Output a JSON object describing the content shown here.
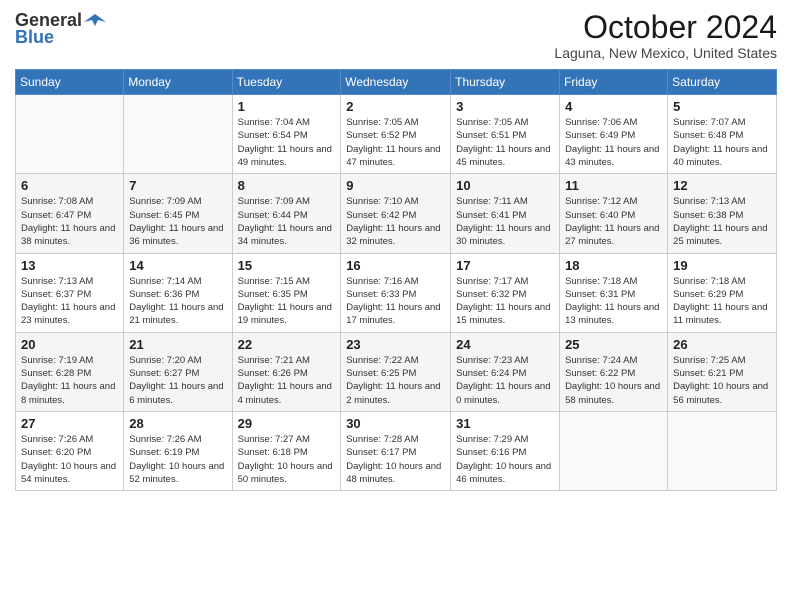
{
  "header": {
    "logo_general": "General",
    "logo_blue": "Blue",
    "month_title": "October 2024",
    "location": "Laguna, New Mexico, United States"
  },
  "weekdays": [
    "Sunday",
    "Monday",
    "Tuesday",
    "Wednesday",
    "Thursday",
    "Friday",
    "Saturday"
  ],
  "weeks": [
    [
      {
        "day": "",
        "info": ""
      },
      {
        "day": "",
        "info": ""
      },
      {
        "day": "1",
        "info": "Sunrise: 7:04 AM\nSunset: 6:54 PM\nDaylight: 11 hours and 49 minutes."
      },
      {
        "day": "2",
        "info": "Sunrise: 7:05 AM\nSunset: 6:52 PM\nDaylight: 11 hours and 47 minutes."
      },
      {
        "day": "3",
        "info": "Sunrise: 7:05 AM\nSunset: 6:51 PM\nDaylight: 11 hours and 45 minutes."
      },
      {
        "day": "4",
        "info": "Sunrise: 7:06 AM\nSunset: 6:49 PM\nDaylight: 11 hours and 43 minutes."
      },
      {
        "day": "5",
        "info": "Sunrise: 7:07 AM\nSunset: 6:48 PM\nDaylight: 11 hours and 40 minutes."
      }
    ],
    [
      {
        "day": "6",
        "info": "Sunrise: 7:08 AM\nSunset: 6:47 PM\nDaylight: 11 hours and 38 minutes."
      },
      {
        "day": "7",
        "info": "Sunrise: 7:09 AM\nSunset: 6:45 PM\nDaylight: 11 hours and 36 minutes."
      },
      {
        "day": "8",
        "info": "Sunrise: 7:09 AM\nSunset: 6:44 PM\nDaylight: 11 hours and 34 minutes."
      },
      {
        "day": "9",
        "info": "Sunrise: 7:10 AM\nSunset: 6:42 PM\nDaylight: 11 hours and 32 minutes."
      },
      {
        "day": "10",
        "info": "Sunrise: 7:11 AM\nSunset: 6:41 PM\nDaylight: 11 hours and 30 minutes."
      },
      {
        "day": "11",
        "info": "Sunrise: 7:12 AM\nSunset: 6:40 PM\nDaylight: 11 hours and 27 minutes."
      },
      {
        "day": "12",
        "info": "Sunrise: 7:13 AM\nSunset: 6:38 PM\nDaylight: 11 hours and 25 minutes."
      }
    ],
    [
      {
        "day": "13",
        "info": "Sunrise: 7:13 AM\nSunset: 6:37 PM\nDaylight: 11 hours and 23 minutes."
      },
      {
        "day": "14",
        "info": "Sunrise: 7:14 AM\nSunset: 6:36 PM\nDaylight: 11 hours and 21 minutes."
      },
      {
        "day": "15",
        "info": "Sunrise: 7:15 AM\nSunset: 6:35 PM\nDaylight: 11 hours and 19 minutes."
      },
      {
        "day": "16",
        "info": "Sunrise: 7:16 AM\nSunset: 6:33 PM\nDaylight: 11 hours and 17 minutes."
      },
      {
        "day": "17",
        "info": "Sunrise: 7:17 AM\nSunset: 6:32 PM\nDaylight: 11 hours and 15 minutes."
      },
      {
        "day": "18",
        "info": "Sunrise: 7:18 AM\nSunset: 6:31 PM\nDaylight: 11 hours and 13 minutes."
      },
      {
        "day": "19",
        "info": "Sunrise: 7:18 AM\nSunset: 6:29 PM\nDaylight: 11 hours and 11 minutes."
      }
    ],
    [
      {
        "day": "20",
        "info": "Sunrise: 7:19 AM\nSunset: 6:28 PM\nDaylight: 11 hours and 8 minutes."
      },
      {
        "day": "21",
        "info": "Sunrise: 7:20 AM\nSunset: 6:27 PM\nDaylight: 11 hours and 6 minutes."
      },
      {
        "day": "22",
        "info": "Sunrise: 7:21 AM\nSunset: 6:26 PM\nDaylight: 11 hours and 4 minutes."
      },
      {
        "day": "23",
        "info": "Sunrise: 7:22 AM\nSunset: 6:25 PM\nDaylight: 11 hours and 2 minutes."
      },
      {
        "day": "24",
        "info": "Sunrise: 7:23 AM\nSunset: 6:24 PM\nDaylight: 11 hours and 0 minutes."
      },
      {
        "day": "25",
        "info": "Sunrise: 7:24 AM\nSunset: 6:22 PM\nDaylight: 10 hours and 58 minutes."
      },
      {
        "day": "26",
        "info": "Sunrise: 7:25 AM\nSunset: 6:21 PM\nDaylight: 10 hours and 56 minutes."
      }
    ],
    [
      {
        "day": "27",
        "info": "Sunrise: 7:26 AM\nSunset: 6:20 PM\nDaylight: 10 hours and 54 minutes."
      },
      {
        "day": "28",
        "info": "Sunrise: 7:26 AM\nSunset: 6:19 PM\nDaylight: 10 hours and 52 minutes."
      },
      {
        "day": "29",
        "info": "Sunrise: 7:27 AM\nSunset: 6:18 PM\nDaylight: 10 hours and 50 minutes."
      },
      {
        "day": "30",
        "info": "Sunrise: 7:28 AM\nSunset: 6:17 PM\nDaylight: 10 hours and 48 minutes."
      },
      {
        "day": "31",
        "info": "Sunrise: 7:29 AM\nSunset: 6:16 PM\nDaylight: 10 hours and 46 minutes."
      },
      {
        "day": "",
        "info": ""
      },
      {
        "day": "",
        "info": ""
      }
    ]
  ]
}
